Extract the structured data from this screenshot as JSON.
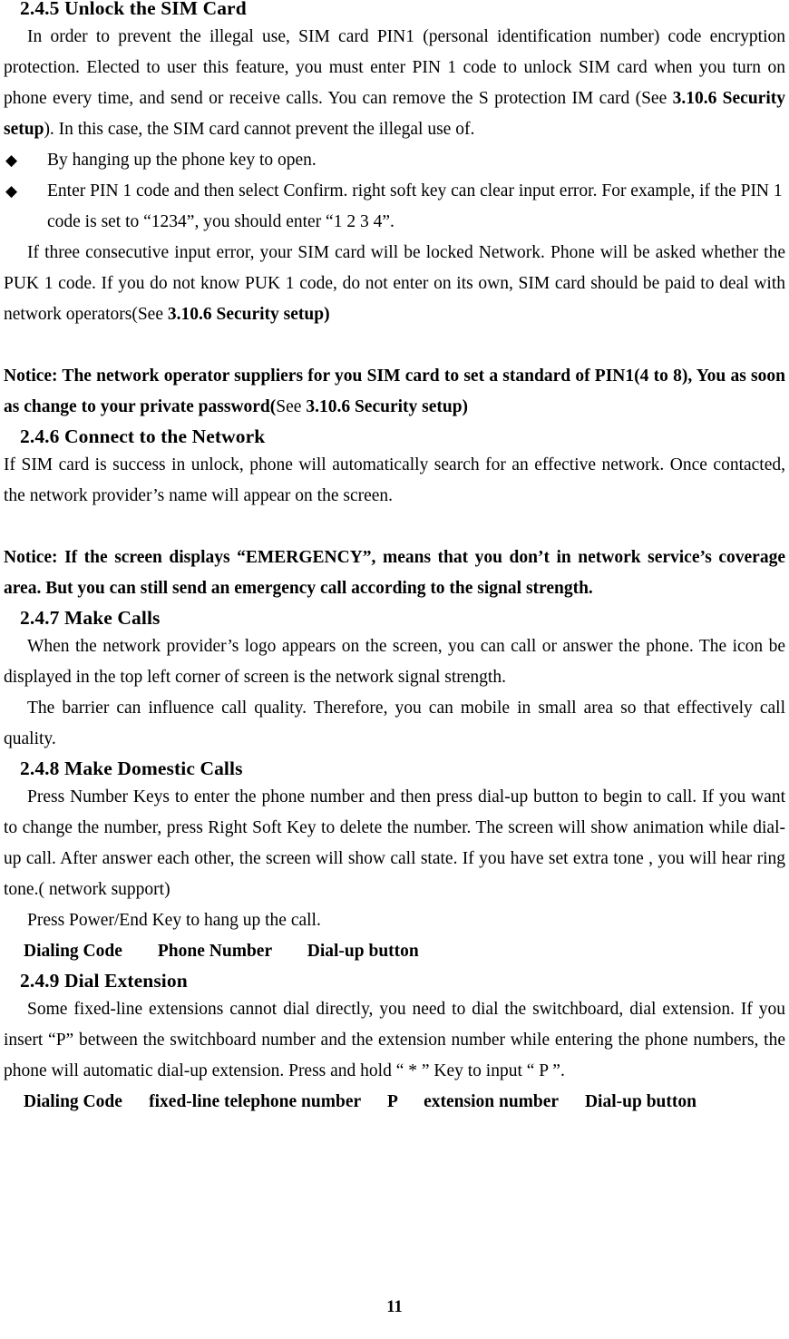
{
  "document": {
    "page_number": "11",
    "bullet_glyph": "◆"
  },
  "sections": {
    "s245": {
      "heading": "2.4.5 Unlock the SIM Card",
      "para1_a": "In order to prevent the illegal use, SIM card PIN1 (personal identification number) code encryption protection. Elected to user this feature, you must enter PIN 1 code to unlock SIM card when you turn on phone every time, and send or receive calls. You can remove the S protection IM card (See ",
      "para1_bold": "3.10.6 Security setup",
      "para1_c": "). In this case, the SIM card cannot prevent the illegal use of.",
      "bullet1": "By hanging up the phone key to open.",
      "bullet2": "Enter PIN 1 code and then select Confirm. right soft key can clear input error. For example, if the PIN 1 code is set to “1234”, you should enter “1 2 3 4”.",
      "para2_a": "If three consecutive input error, your SIM card will be locked Network. Phone will be asked whether the PUK 1 code. If you do not know PUK 1 code, do not enter on its own, SIM card should be paid to deal with network operators(See ",
      "para2_bold": "3.10.6 Security setup)",
      "notice_a": "Notice: The network operator suppliers for you SIM card to set a standard of PIN1(4 to 8), You as soon as change to your private password(",
      "notice_reg": "See ",
      "notice_b": "3.10.6 Security setup)"
    },
    "s246": {
      "heading": "2.4.6 Connect to the Network",
      "para1": "If SIM card is success in unlock, phone will automatically search for an effective network. Once contacted, the network provider’s name will appear on the screen.",
      "notice": "Notice: If the screen displays “EMERGENCY”, means that you don’t in network service’s coverage area. But you can still send an emergency call according to the signal strength."
    },
    "s247": {
      "heading": "2.4.7 Make Calls",
      "para1": "When the network provider’s logo appears on the screen, you can call or answer the phone. The icon be displayed in the top left corner of screen is the network signal strength.",
      "para2": "The barrier can influence call quality. Therefore, you can mobile in small area so that effectively call quality."
    },
    "s248": {
      "heading": "2.4.8 Make Domestic Calls",
      "para1": "Press Number Keys to enter the phone number and then press dial-up button to begin to call. If you want to change the number, press Right Soft Key to delete the number. The screen will show animation while dial-up call. After answer each other, the screen will show call state. If you have set extra tone ,    you will hear ring tone.( network support)",
      "para2": "Press Power/End Key to hang up the call.",
      "label_row": "Dialing Code        Phone Number        Dial-up button"
    },
    "s249": {
      "heading": "2.4.9 Dial Extension",
      "para1": "Some fixed-line extensions cannot dial directly, you need to dial the switchboard, dial extension. If you insert “P” between the switchboard number and the extension number while entering the phone numbers, the phone will automatic dial-up extension. Press and hold “ * ”   Key to input “ P ”.",
      "label_row": "Dialing Code      fixed-line telephone number      P      extension number      Dial-up button"
    }
  }
}
